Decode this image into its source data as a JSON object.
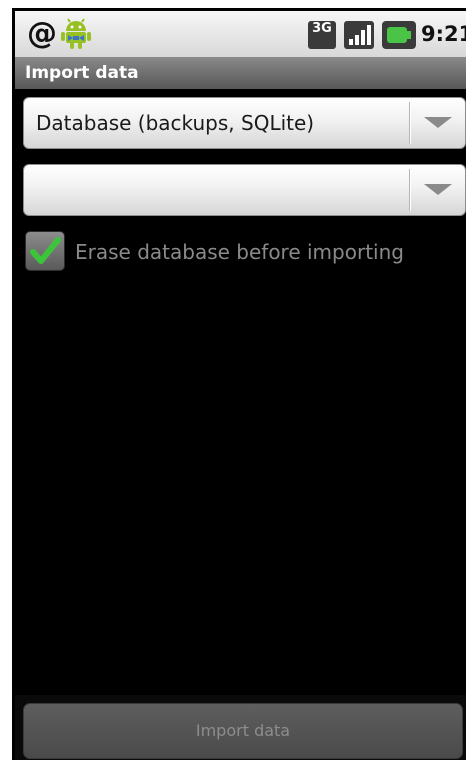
{
  "status_bar": {
    "time": "9:21",
    "network_type": "3G",
    "icons": [
      "at-sign-icon",
      "android-notification-icon",
      "3g-data-icon",
      "signal-strength-icon",
      "battery-charging-icon"
    ]
  },
  "title_bar": {
    "title": "Import data"
  },
  "format_spinner": {
    "selected": "Database (backups, SQLite)"
  },
  "file_spinner": {
    "selected": ""
  },
  "erase_checkbox": {
    "label": "Erase database before importing",
    "checked": true
  },
  "import_button": {
    "label": "Import data",
    "enabled": false
  },
  "colors": {
    "title_bar": "#6e6e6e",
    "check_green": "#3cc43a",
    "battery_green": "#49c447",
    "disabled_text": "#8d8d8d"
  }
}
